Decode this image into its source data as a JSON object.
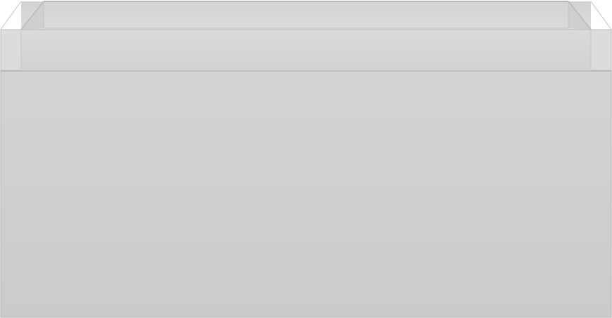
{
  "scene": {
    "subject": "drawer-unit",
    "colors": {
      "background": "#ffffff",
      "front": "#d1d1cf",
      "front_shade": "#cbcbc9",
      "rim": "#d6d6d4",
      "inner_back": "#d9d9d7",
      "edge": "#b8b8b6",
      "interior_shadow": "#bdbdbb"
    }
  }
}
